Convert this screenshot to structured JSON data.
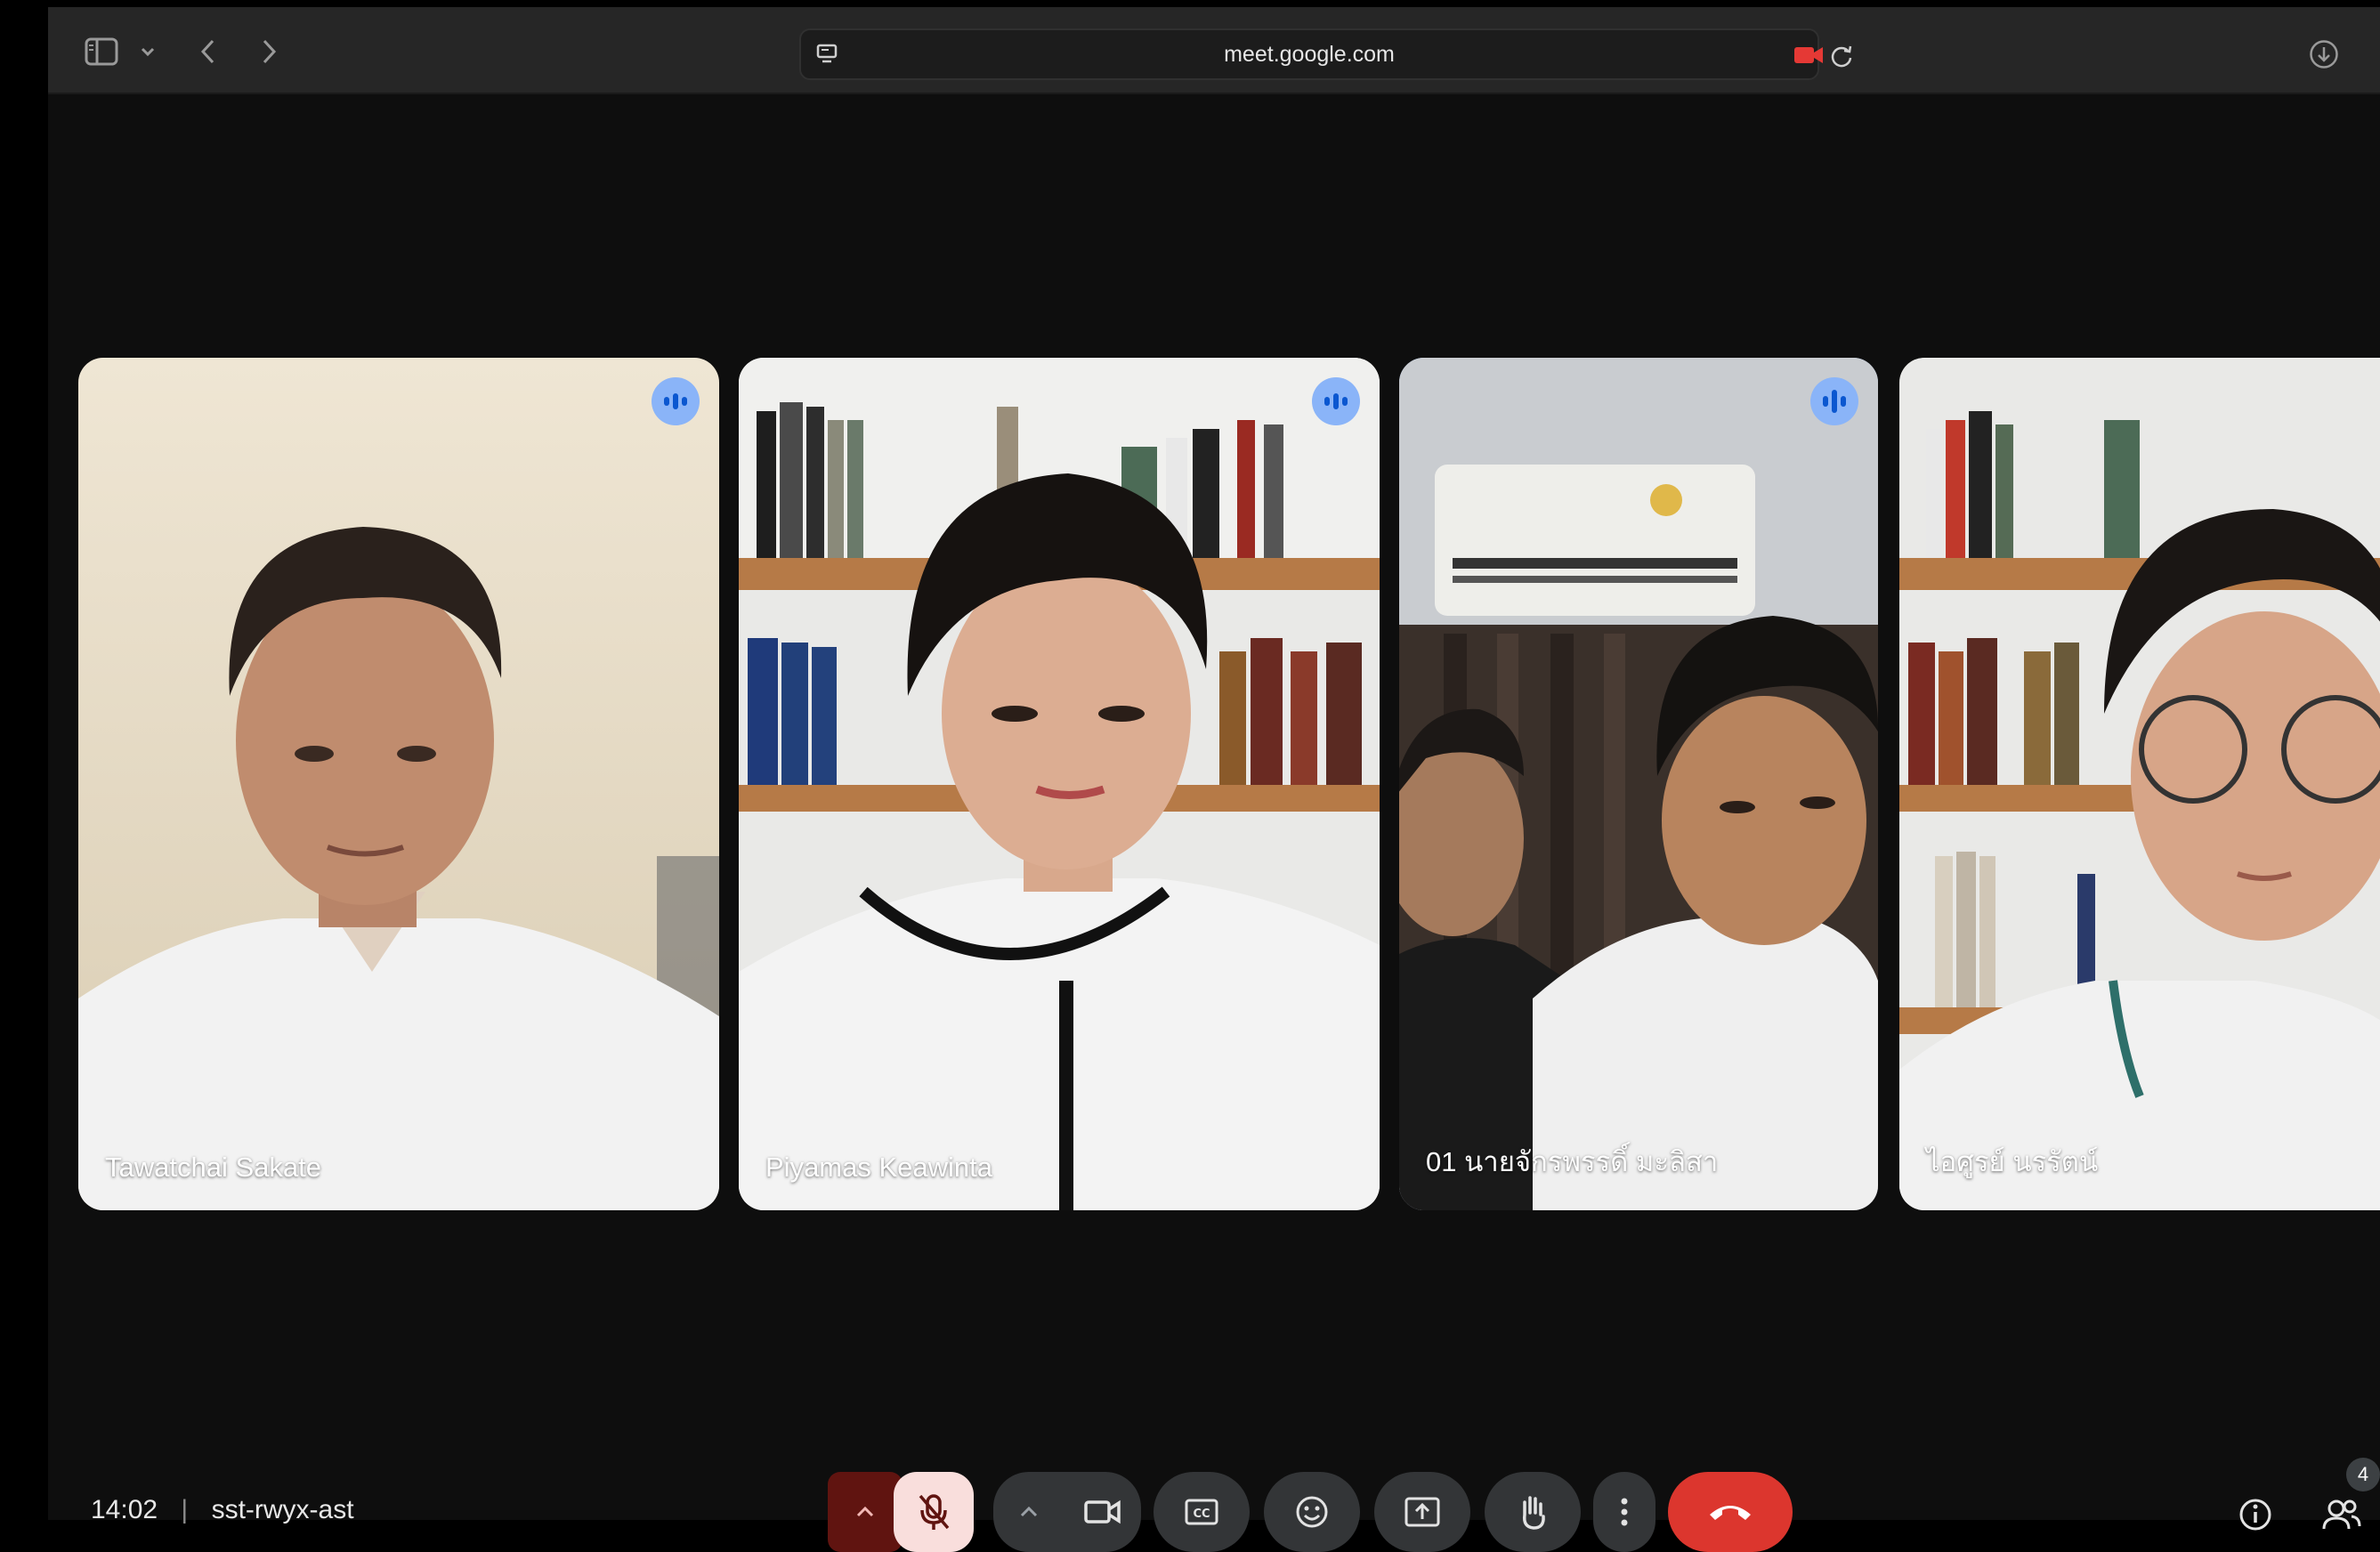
{
  "browser": {
    "url": "meet.google.com",
    "icons": [
      "sidebar-icon",
      "chevron-down-icon",
      "back-icon",
      "forward-icon",
      "page-settings-icon",
      "camera-recording-icon",
      "reload-icon",
      "downloads-icon"
    ]
  },
  "participants": [
    {
      "name": "Tawatchai Sakate",
      "speaking": true
    },
    {
      "name": "Piyamas Keawinta",
      "speaking": true
    },
    {
      "name": "01 นายจักรพรรดิ์ มะลิสา",
      "speaking": true,
      "active": true
    },
    {
      "name": "ไอศูรย์ นรรัตน์",
      "speaking": false
    }
  ],
  "meeting": {
    "time": "14:02",
    "separator": "|",
    "code": "sst-rwyx-ast",
    "participant_count": "4"
  },
  "controls": {
    "icons": [
      "mic-options-chevron-icon",
      "mic-off-icon",
      "camera-options-chevron-icon",
      "camera-icon",
      "captions-icon",
      "emoji-icon",
      "present-icon",
      "raise-hand-icon",
      "more-options-icon",
      "end-call-icon",
      "info-icon",
      "people-icon"
    ],
    "colors": {
      "end_call": "#dc362e",
      "mic_off_bg": "#f9dedc",
      "mic_chevron_bg": "#601410"
    }
  }
}
